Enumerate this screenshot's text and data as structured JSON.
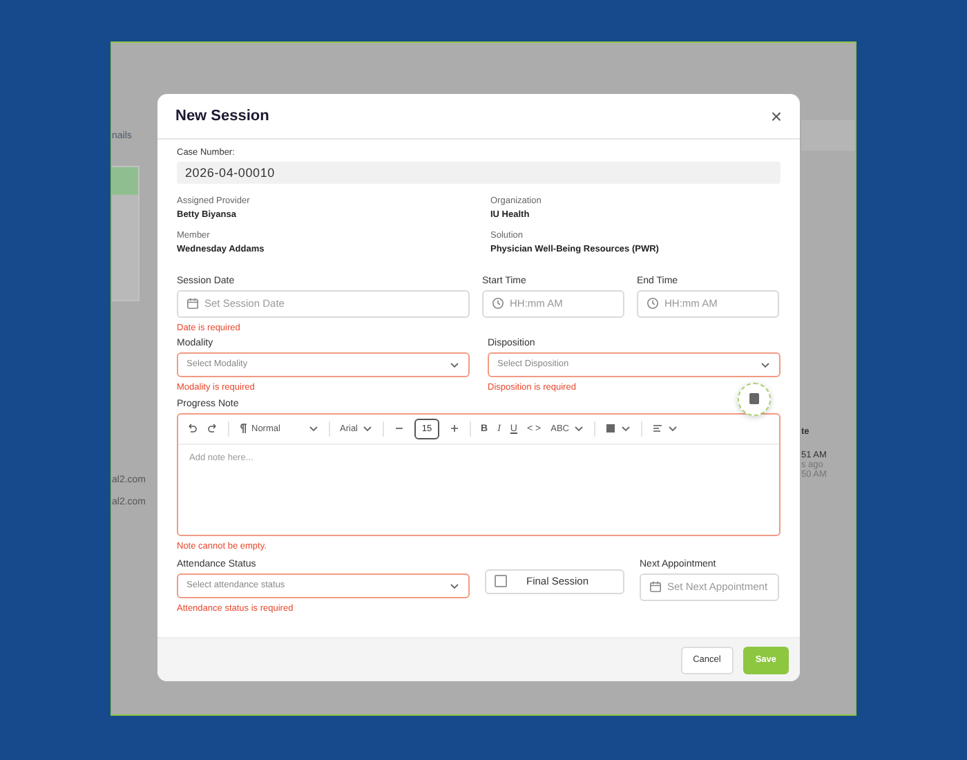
{
  "backdrop": {
    "left_texts": [
      "nails",
      "al2.com",
      "al2.com"
    ],
    "right_texts": [
      "te",
      "51 AM",
      "s ago",
      "50 AM"
    ]
  },
  "modal": {
    "title": "New Session",
    "close": "×",
    "case_number": {
      "label": "Case Number:",
      "value": "2026-04-00010"
    },
    "details": [
      {
        "label": "Assigned Provider",
        "value": "Betty Biyansa"
      },
      {
        "label": "Organization",
        "value": "IU Health"
      },
      {
        "label": "Member",
        "value": "Wednesday Addams"
      },
      {
        "label": "Solution",
        "value": "Physician Well-Being Resources (PWR)"
      }
    ],
    "session_date": {
      "label": "Session Date",
      "placeholder": "Set Session Date",
      "invalid": false,
      "error": "Date is required"
    },
    "start_time": {
      "label": "Start Time",
      "placeholder": "HH:mm AM"
    },
    "end_time": {
      "label": "End Time",
      "placeholder": "HH:mm AM"
    },
    "modality": {
      "label": "Modality",
      "placeholder": "Select Modality",
      "invalid": true,
      "error": "Modality is required"
    },
    "disposition": {
      "label": "Disposition",
      "placeholder": "Select Disposition",
      "invalid": true,
      "error": "Disposition is required"
    },
    "progress_note": {
      "label": "Progress Note",
      "placeholder": "Add note here...",
      "invalid": true,
      "error": "Note cannot be empty.",
      "toolbar": [
        {
          "kind": "undo"
        },
        {
          "kind": "redo"
        },
        {
          "kind": "sep"
        },
        {
          "kind": "block",
          "text": "Normal"
        },
        {
          "kind": "sep"
        },
        {
          "kind": "font",
          "text": "Arial"
        },
        {
          "kind": "sep"
        },
        {
          "kind": "minus"
        },
        {
          "kind": "size",
          "text": "15"
        },
        {
          "kind": "plus"
        },
        {
          "kind": "sep"
        },
        {
          "kind": "bold",
          "text": "B"
        },
        {
          "kind": "italic",
          "text": "I"
        },
        {
          "kind": "underline",
          "text": "U"
        },
        {
          "kind": "code",
          "text": "< >"
        },
        {
          "kind": "case",
          "text": "ABC"
        },
        {
          "kind": "sep"
        },
        {
          "kind": "color"
        },
        {
          "kind": "sep"
        },
        {
          "kind": "align"
        }
      ]
    },
    "attendance_status": {
      "label": "Attendance Status",
      "placeholder": "Select attendance status",
      "invalid": true,
      "error": "Attendance status is required"
    },
    "final_session": {
      "label": "Final Session",
      "checked": false
    },
    "next_appointment": {
      "label": "Next Appointment",
      "placeholder": "Set Next Appointment"
    },
    "buttons": [
      {
        "kind": "secondary",
        "label": "Cancel"
      },
      {
        "kind": "primary",
        "label": "Save"
      }
    ]
  }
}
